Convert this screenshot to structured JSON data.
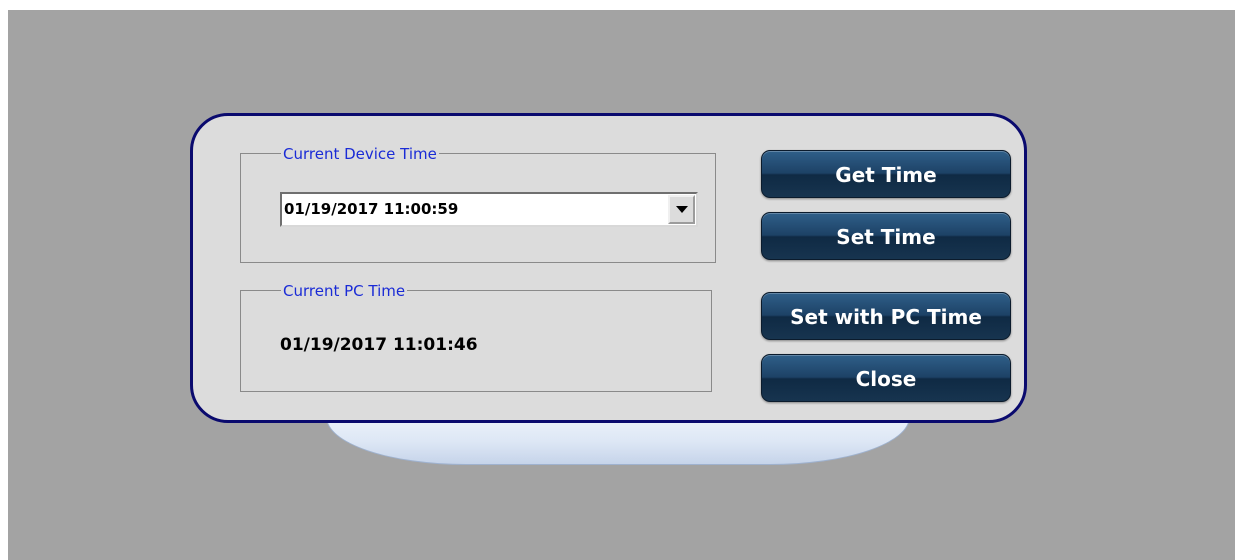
{
  "dialog": {
    "device_time_group": {
      "legend": "Current Device Time",
      "selected_value": "01/19/2017 11:00:59"
    },
    "pc_time_group": {
      "legend": "Current PC Time",
      "value": "01/19/2017 11:01:46"
    },
    "buttons": {
      "get_time": "Get Time",
      "set_time": "Set Time",
      "set_with_pc_time": "Set with PC Time",
      "close": "Close"
    }
  },
  "colors": {
    "background": "#a3a3a3",
    "panel": "#dcdcdc",
    "panel_border": "#0a0a6e",
    "legend_text": "#1a2bd6",
    "button": "#1d4266"
  },
  "icons": {
    "dropdown": "chevron-down-icon"
  }
}
